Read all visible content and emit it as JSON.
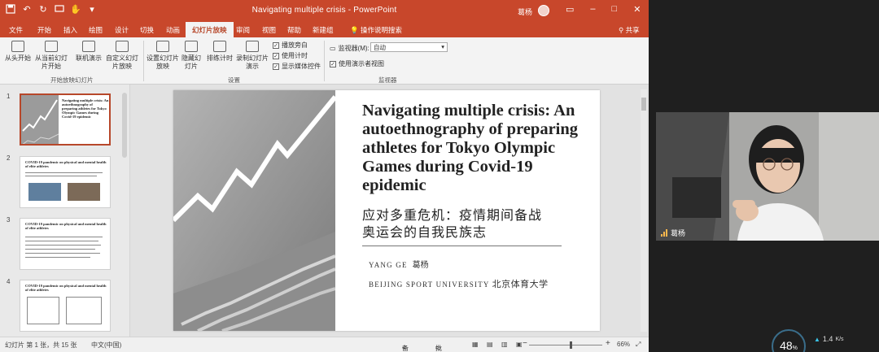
{
  "app": {
    "title": "Navigating multiple crisis  -  PowerPoint",
    "user": "葛杨",
    "window_controls": [
      "–",
      "□",
      "✕"
    ]
  },
  "tabs": [
    "文件",
    "开始",
    "插入",
    "绘图",
    "设计",
    "切换",
    "动画",
    "幻灯片放映",
    "审阅",
    "视图",
    "帮助",
    "新建组"
  ],
  "active_tab": "幻灯片放映",
  "tell_me": "操作说明搜索",
  "share": "共享",
  "ribbon": {
    "start_group": {
      "label": "开始放映幻灯片",
      "buttons": [
        "从头开始",
        "从当前幻灯片开始",
        "联机演示",
        "自定义幻灯片放映"
      ]
    },
    "setup_group": {
      "label": "设置",
      "buttons": [
        "设置幻灯片放映",
        "隐藏幻灯片",
        "排练计时",
        "录制幻灯片演示"
      ],
      "checkboxes": [
        "播放旁白",
        "使用计时",
        "显示媒体控件"
      ]
    },
    "monitor_group": {
      "label": "监视器",
      "monitor_label": "监视器(M):",
      "monitor_value": "自动",
      "presenter_view": "使用演示者视图"
    }
  },
  "thumbnails": [
    {
      "num": "1",
      "title": "Navigating multiple crisis: An autoethnography of preparing athletes for Tokyo Olympic Games during Covid-19 epidemic"
    },
    {
      "num": "2",
      "title": "COVID-19 pandemic on physical and mental health of elite athletes"
    },
    {
      "num": "3",
      "title": "COVID-19 pandemic on physical and mental health of elite athletes"
    },
    {
      "num": "4",
      "title": "COVID-19 pandemic on physical and mental health of elite athletes"
    }
  ],
  "slide": {
    "title_en": "Navigating multiple crisis: An autoethnography of preparing athletes for Tokyo Olympic Games during Covid-19 epidemic",
    "title_cn_line1": "应对多重危机：疫情期间备战",
    "title_cn_line2": "奥运会的自我民族志",
    "author_en": "YANG GE",
    "author_cn": "葛杨",
    "affiliation_en": "BEIJING SPORT UNIVERSITY",
    "affiliation_cn": "北京体育大学"
  },
  "status": {
    "slide_count": "幻灯片 第 1 张，共 15 张",
    "language": "中文(中国)",
    "notes": "备注",
    "comments": "批注",
    "zoom": "66%"
  },
  "video": {
    "name": "葛杨"
  },
  "network": {
    "gauge_value": "48",
    "gauge_unit": "%",
    "upload": "1.4",
    "upload_unit": "K/s"
  },
  "colors": {
    "accent": "#c8472b",
    "background": "#1f1f1f"
  }
}
